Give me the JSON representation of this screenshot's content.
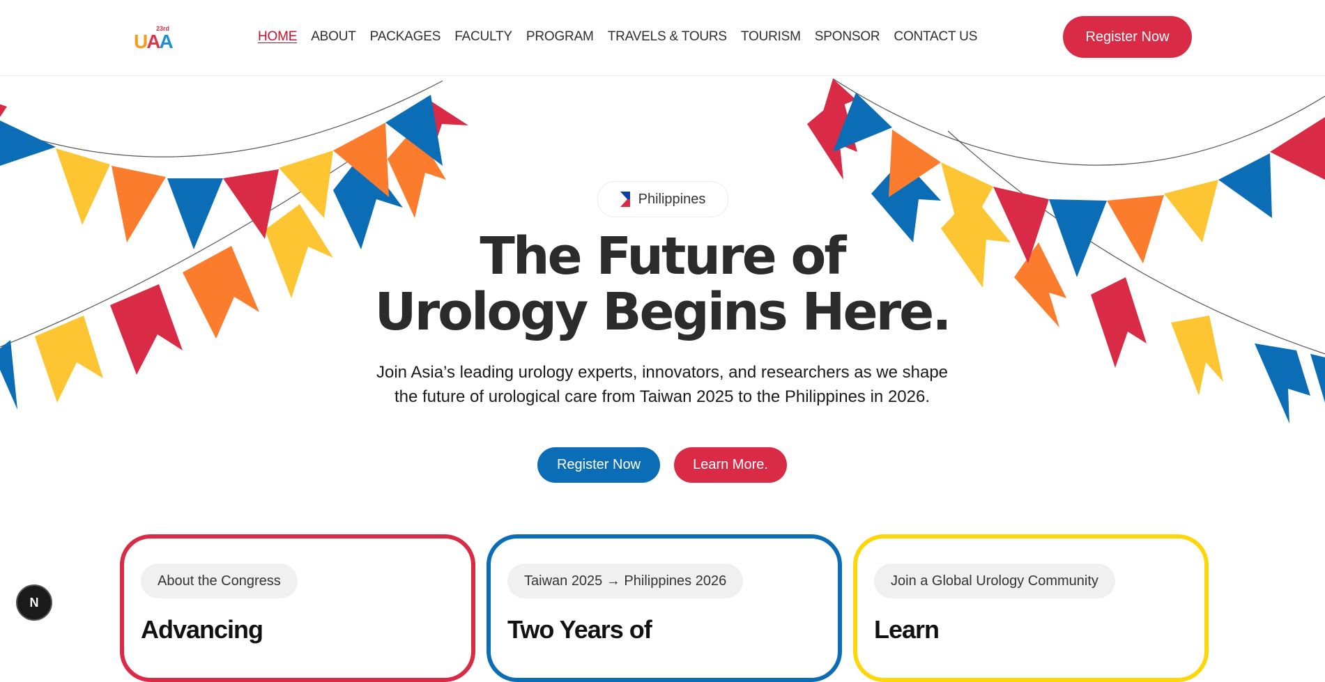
{
  "logo": {
    "text_u": "U",
    "text_a1": "A",
    "text_a2": "A",
    "sup": "23rd"
  },
  "nav": {
    "items": [
      {
        "label": "HOME",
        "active": true
      },
      {
        "label": "ABOUT"
      },
      {
        "label": "PACKAGES"
      },
      {
        "label": "FACULTY"
      },
      {
        "label": "PROGRAM"
      },
      {
        "label": "TRAVELS & TOURS"
      },
      {
        "label": "TOURISM"
      },
      {
        "label": "SPONSOR"
      },
      {
        "label": "CONTACT US"
      }
    ],
    "cta": "Register Now"
  },
  "hero": {
    "country": "Philippines",
    "title_line1": "The Future of",
    "title_line2": "Urology Begins Here.",
    "subtitle": "Join Asia’s leading urology experts, innovators, and researchers as we shape the future of urological care from Taiwan 2025 to the Philippines in 2026.",
    "primary_button": "Register Now",
    "secondary_button": "Learn More."
  },
  "cards": [
    {
      "pill": "About the Congress",
      "title": "Advancing"
    },
    {
      "pill": "Taiwan 2025 → Philippines 2026",
      "title": "Two Years of"
    },
    {
      "pill": "Join a Global Urology Community",
      "title": "Learn"
    }
  ],
  "dev_badge": {
    "letter": "N"
  },
  "colors": {
    "red": "#d92b45",
    "blue": "#0b6db5",
    "yellow": "#fcc531",
    "orange": "#fb7c2c",
    "card_yellow_border": "#ffd60a"
  },
  "icons": [
    "philippines-flag-icon",
    "nextjs-dev-icon"
  ]
}
